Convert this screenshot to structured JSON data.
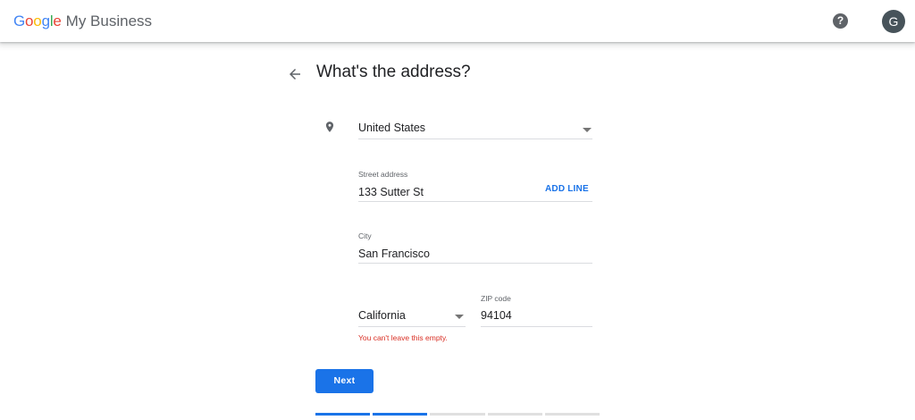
{
  "header": {
    "brand_google_letters": [
      {
        "ch": "G",
        "color": "#4285F4"
      },
      {
        "ch": "o",
        "color": "#EA4335"
      },
      {
        "ch": "o",
        "color": "#FBBC05"
      },
      {
        "ch": "g",
        "color": "#4285F4"
      },
      {
        "ch": "l",
        "color": "#34A853"
      },
      {
        "ch": "e",
        "color": "#EA4335"
      }
    ],
    "brand_product": "My Business",
    "help_icon_glyph": "?",
    "avatar_initial": "G"
  },
  "form": {
    "title": "What's the address?",
    "country": {
      "value": "United States"
    },
    "street": {
      "label": "Street address",
      "value": "133 Sutter St",
      "add_line_label": "ADD LINE"
    },
    "city": {
      "label": "City",
      "value": "San Francisco"
    },
    "state": {
      "value": "California",
      "error": "You can't leave this empty."
    },
    "zip": {
      "label": "ZIP code",
      "value": "94104"
    },
    "next_label": "Next"
  },
  "progress": {
    "total_steps": 5,
    "completed_steps": 2
  },
  "colors": {
    "accent": "#1a73e8",
    "error": "#d93025",
    "avatar_bg": "#47535a"
  }
}
